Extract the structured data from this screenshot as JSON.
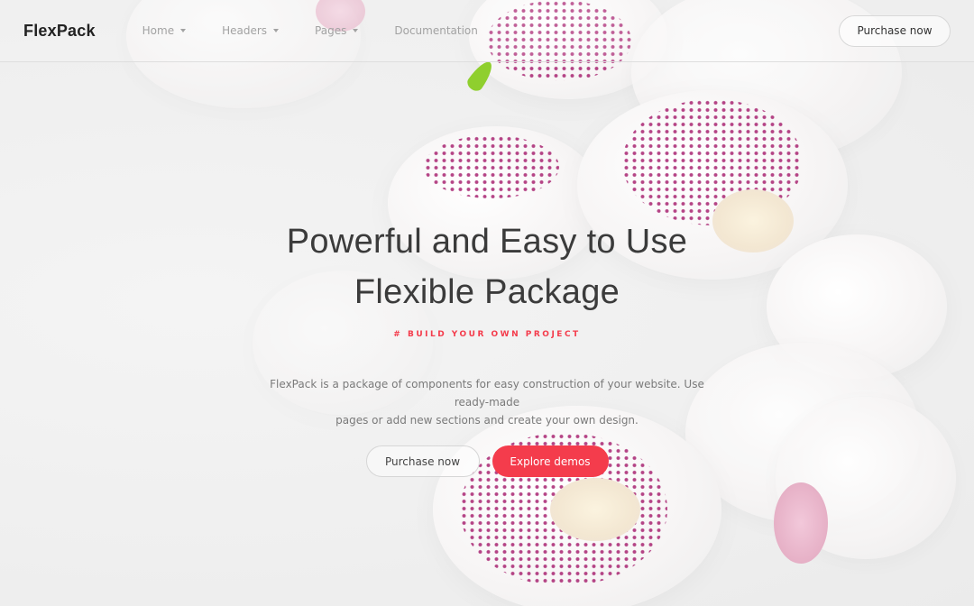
{
  "brand": {
    "name": "FlexPack"
  },
  "nav": [
    {
      "label": "Home",
      "has_dropdown": true
    },
    {
      "label": "Headers",
      "has_dropdown": true
    },
    {
      "label": "Pages",
      "has_dropdown": true
    },
    {
      "label": "Documentation",
      "has_dropdown": false
    }
  ],
  "header": {
    "cta_label": "Purchase now"
  },
  "hero": {
    "title_line1": "Powerful and Easy to Use",
    "title_line2": "Flexible Package",
    "tagline": "# BUILD YOUR OWN PROJECT",
    "description_line1": "FlexPack is a package of components for easy construction of your website. Use ready-made",
    "description_line2": "pages or add new sections and create your own design.",
    "secondary_button": "Purchase now",
    "primary_button": "Explore demos"
  },
  "colors": {
    "accent": "#f43c4c",
    "text_dark": "#3b3b3b",
    "text_muted": "#7a7a7a",
    "nav_text": "#a2a2a2"
  },
  "background_image": "white-orchid-flowers-photo"
}
